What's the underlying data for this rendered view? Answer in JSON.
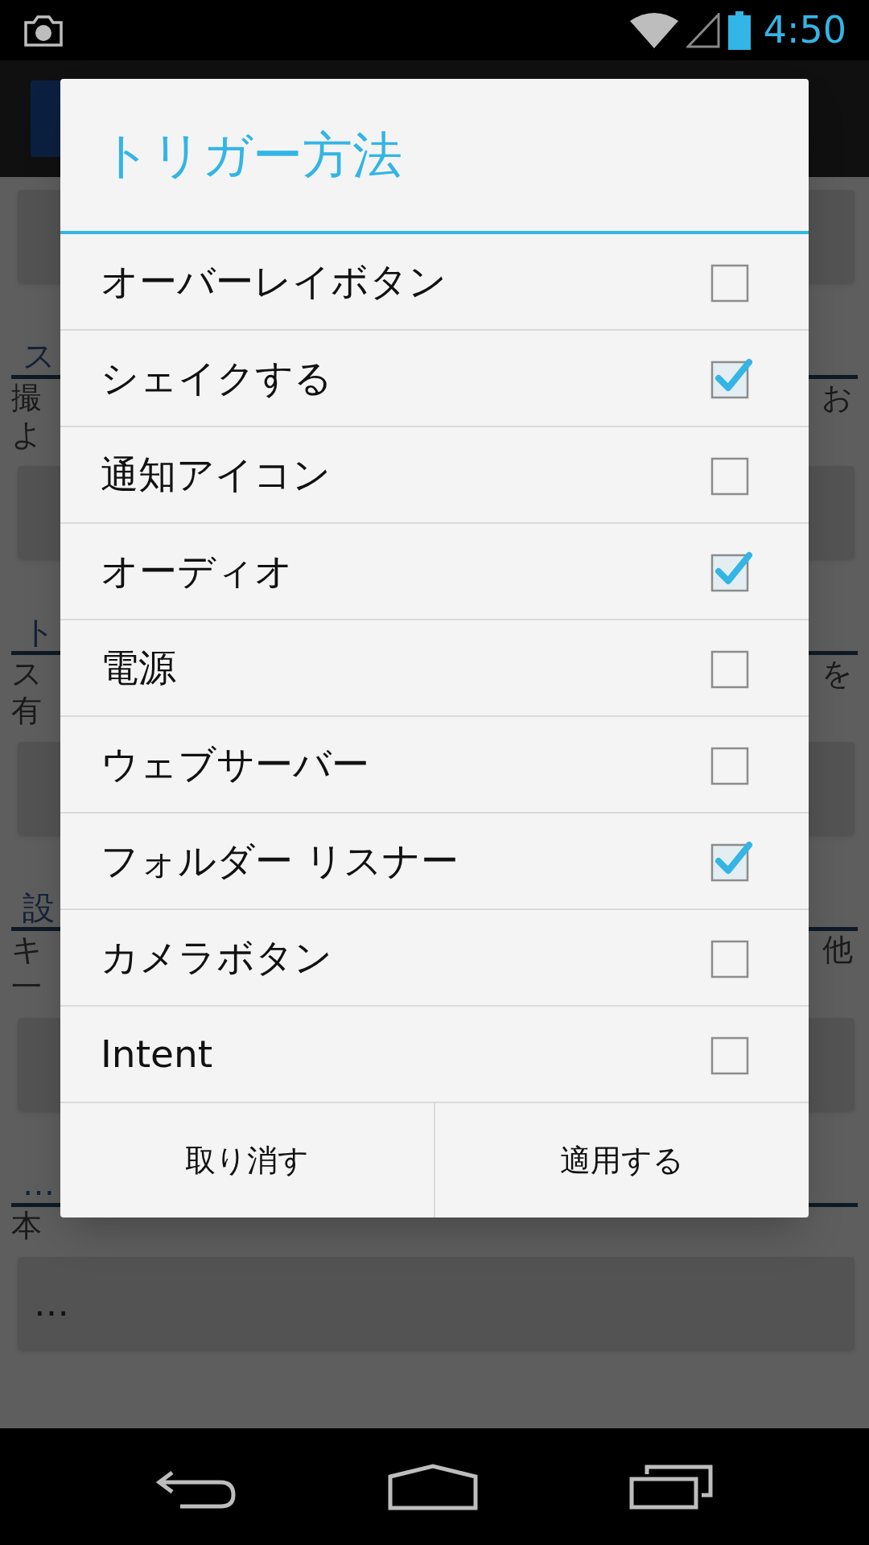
{
  "status_bar": {
    "time": "4:50"
  },
  "background": [
    {
      "kind": "button"
    },
    {
      "kind": "header",
      "left": "ス"
    },
    {
      "kind": "text",
      "left": "撮",
      "right": "お"
    },
    {
      "kind": "text",
      "left": "よ"
    },
    {
      "kind": "button"
    },
    {
      "kind": "header",
      "left": "ト"
    },
    {
      "kind": "text",
      "left": "ス",
      "right": "を"
    },
    {
      "kind": "text",
      "left": "有"
    },
    {
      "kind": "button"
    },
    {
      "kind": "header",
      "left": "設"
    },
    {
      "kind": "text",
      "left": "キ",
      "right": "他"
    },
    {
      "kind": "text",
      "left": "一"
    },
    {
      "kind": "button"
    },
    {
      "kind": "header",
      "left": "…"
    },
    {
      "kind": "text",
      "left": "本"
    },
    {
      "kind": "button",
      "label": "…"
    }
  ],
  "dialog": {
    "title": "トリガー方法",
    "options": [
      {
        "label": "オーバーレイボタン",
        "checked": false
      },
      {
        "label": "シェイクする",
        "checked": true
      },
      {
        "label": "通知アイコン",
        "checked": false
      },
      {
        "label": "オーディオ",
        "checked": true
      },
      {
        "label": "電源",
        "checked": false
      },
      {
        "label": "ウェブサーバー",
        "checked": false
      },
      {
        "label": "フォルダー リスナー",
        "checked": true
      },
      {
        "label": "カメラボタン",
        "checked": false
      },
      {
        "label": "Intent",
        "checked": false
      }
    ],
    "buttons": [
      "取り消す",
      "適用する"
    ]
  }
}
